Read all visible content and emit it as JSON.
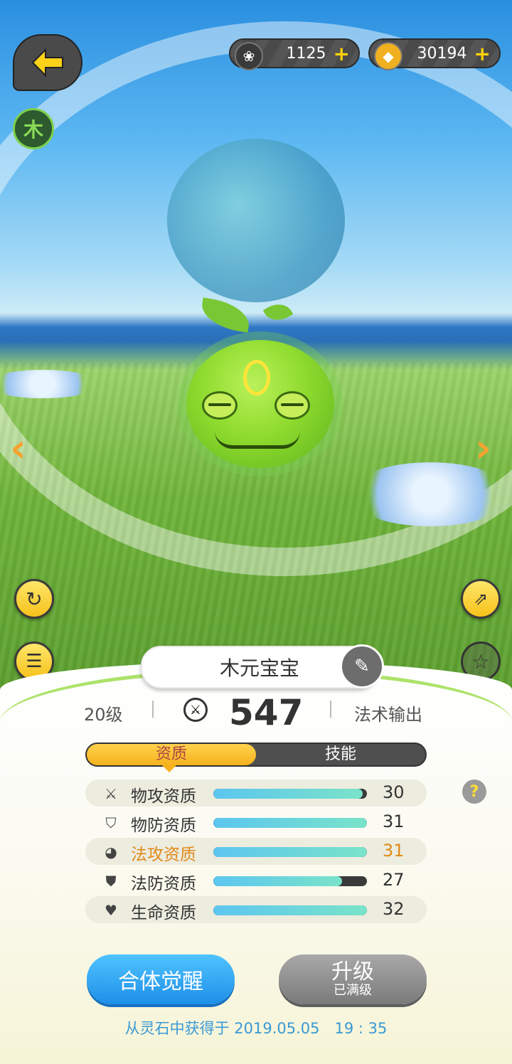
{
  "resources": [
    {
      "icon": "flower-gem-icon",
      "amount": "1125",
      "plus": "+"
    },
    {
      "icon": "gold-crystal-icon",
      "amount": "30194",
      "plus": "+"
    }
  ],
  "element_badge": "木",
  "pet": {
    "name": "木元宝宝",
    "level": "20级",
    "power": "547",
    "role": "法术输出"
  },
  "tabs": [
    {
      "label": "资质",
      "active": true
    },
    {
      "label": "技能",
      "active": false
    }
  ],
  "attributes": [
    {
      "icon": "crossed-swords-icon",
      "label": "物攻资质",
      "value": "30",
      "fill": 0.97,
      "highlight": false
    },
    {
      "icon": "shield-icon",
      "label": "物防资质",
      "value": "31",
      "fill": 1.0,
      "highlight": false
    },
    {
      "icon": "magic-swirl-icon",
      "label": "法攻资质",
      "value": "31",
      "fill": 1.0,
      "highlight": true
    },
    {
      "icon": "magic-shield-icon",
      "label": "法防资质",
      "value": "27",
      "fill": 0.84,
      "highlight": false
    },
    {
      "icon": "heart-icon",
      "label": "生命资质",
      "value": "32",
      "fill": 1.0,
      "highlight": false
    }
  ],
  "buttons": {
    "awaken": "合体觉醒",
    "upgrade": "升级",
    "upgrade_sub": "已满级"
  },
  "help": "?",
  "footer": "从灵石中获得于 2019.05.05　19 : 35",
  "colors": {
    "accent_yellow": "#f5b21d",
    "awaken_blue": "#1e8fe8",
    "highlight_orange": "#e0891a",
    "element_green": "#7cd04b"
  }
}
